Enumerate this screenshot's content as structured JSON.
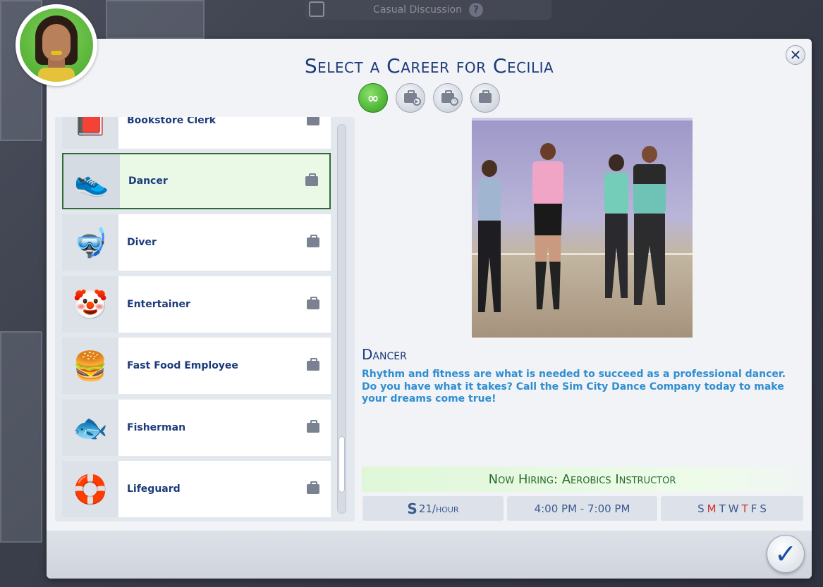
{
  "background": {
    "speech_bubble": "Casual Discussion",
    "help_glyph": "?"
  },
  "dialog": {
    "title": "Select a Career for Cecilia",
    "close_glyph": "✕",
    "confirm_glyph": "✓"
  },
  "filters": [
    {
      "name": "all",
      "glyph": "∞",
      "active": true
    },
    {
      "name": "full-time",
      "glyph": "▶"
    },
    {
      "name": "part-time",
      "glyph": "◷"
    },
    {
      "name": "stacked",
      "glyph": ""
    }
  ],
  "careers": [
    {
      "label": "Bookstore Clerk",
      "icon": "book-icon",
      "glyph": "📕"
    },
    {
      "label": "Dancer",
      "icon": "sneaker-icon",
      "glyph": "👟",
      "selected": true
    },
    {
      "label": "Diver",
      "icon": "diver-icon",
      "glyph": "🤿"
    },
    {
      "label": "Entertainer",
      "icon": "jester-hat-icon",
      "glyph": "🤡"
    },
    {
      "label": "Fast Food Employee",
      "icon": "burger-icon",
      "glyph": "🍔"
    },
    {
      "label": "Fisherman",
      "icon": "fish-icon",
      "glyph": "🐟"
    },
    {
      "label": "Lifeguard",
      "icon": "life-ring-icon",
      "glyph": "🛟"
    }
  ],
  "detail": {
    "title": "Dancer",
    "description": "Rhythm and fitness are what is needed to succeed as a professional dancer. Do you have what it takes? Call the Sim City Dance Company today to make your dreams come true!",
    "hiring": "Now Hiring: Aerobics Instructor",
    "pay_symbol": "S",
    "pay": "21/hour",
    "hours": "4:00 PM - 7:00 PM",
    "days": [
      {
        "d": "S",
        "on": false
      },
      {
        "d": "M",
        "on": true
      },
      {
        "d": "T",
        "on": false
      },
      {
        "d": "W",
        "on": false
      },
      {
        "d": "T",
        "on": true
      },
      {
        "d": "F",
        "on": false
      },
      {
        "d": "S",
        "on": false
      }
    ]
  },
  "colors": {
    "title": "#1d3b7a",
    "description": "#2f8ed0",
    "hiring_text": "#2a6b30",
    "day_on": "#d0302c",
    "filter_active": "#2f9e1e"
  }
}
